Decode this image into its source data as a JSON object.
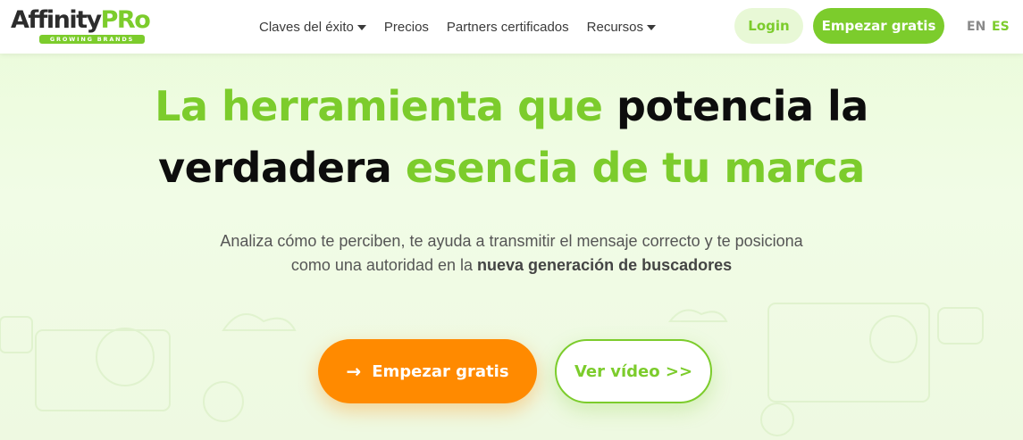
{
  "header": {
    "logo": {
      "part1": "Affinity",
      "part2": "PRo",
      "tagline": "GROWING BRANDS"
    },
    "nav": [
      {
        "label": "Claves del éxito",
        "dropdown": true
      },
      {
        "label": "Precios",
        "dropdown": false
      },
      {
        "label": "Partners certificados",
        "dropdown": false
      },
      {
        "label": "Recursos",
        "dropdown": true
      }
    ],
    "login_label": "Login",
    "start_label": "Empezar gratis",
    "lang_en": "EN",
    "lang_es": "ES"
  },
  "hero": {
    "title_part1": "La herramienta que ",
    "title_part2": "potencia la",
    "title_part3": "verdadera ",
    "title_part4": "esencia de tu marca",
    "subtitle_line1": "Analiza cómo te perciben, te ayuda a transmitir el mensaje correcto y te posiciona",
    "subtitle_line2_prefix": "como una autoridad en la ",
    "subtitle_line2_bold": "nueva generación de buscadores",
    "cta_primary": "Empezar gratis",
    "cta_secondary": "Ver vídeo >>"
  },
  "icons": {
    "cta_primary_arrow": "arrow-right-icon",
    "nav_caret": "caret-down-icon"
  },
  "colors": {
    "brand_green": "#7ccc2c",
    "cta_orange": "#ff8a00",
    "text_dark": "#0d0d0d"
  }
}
